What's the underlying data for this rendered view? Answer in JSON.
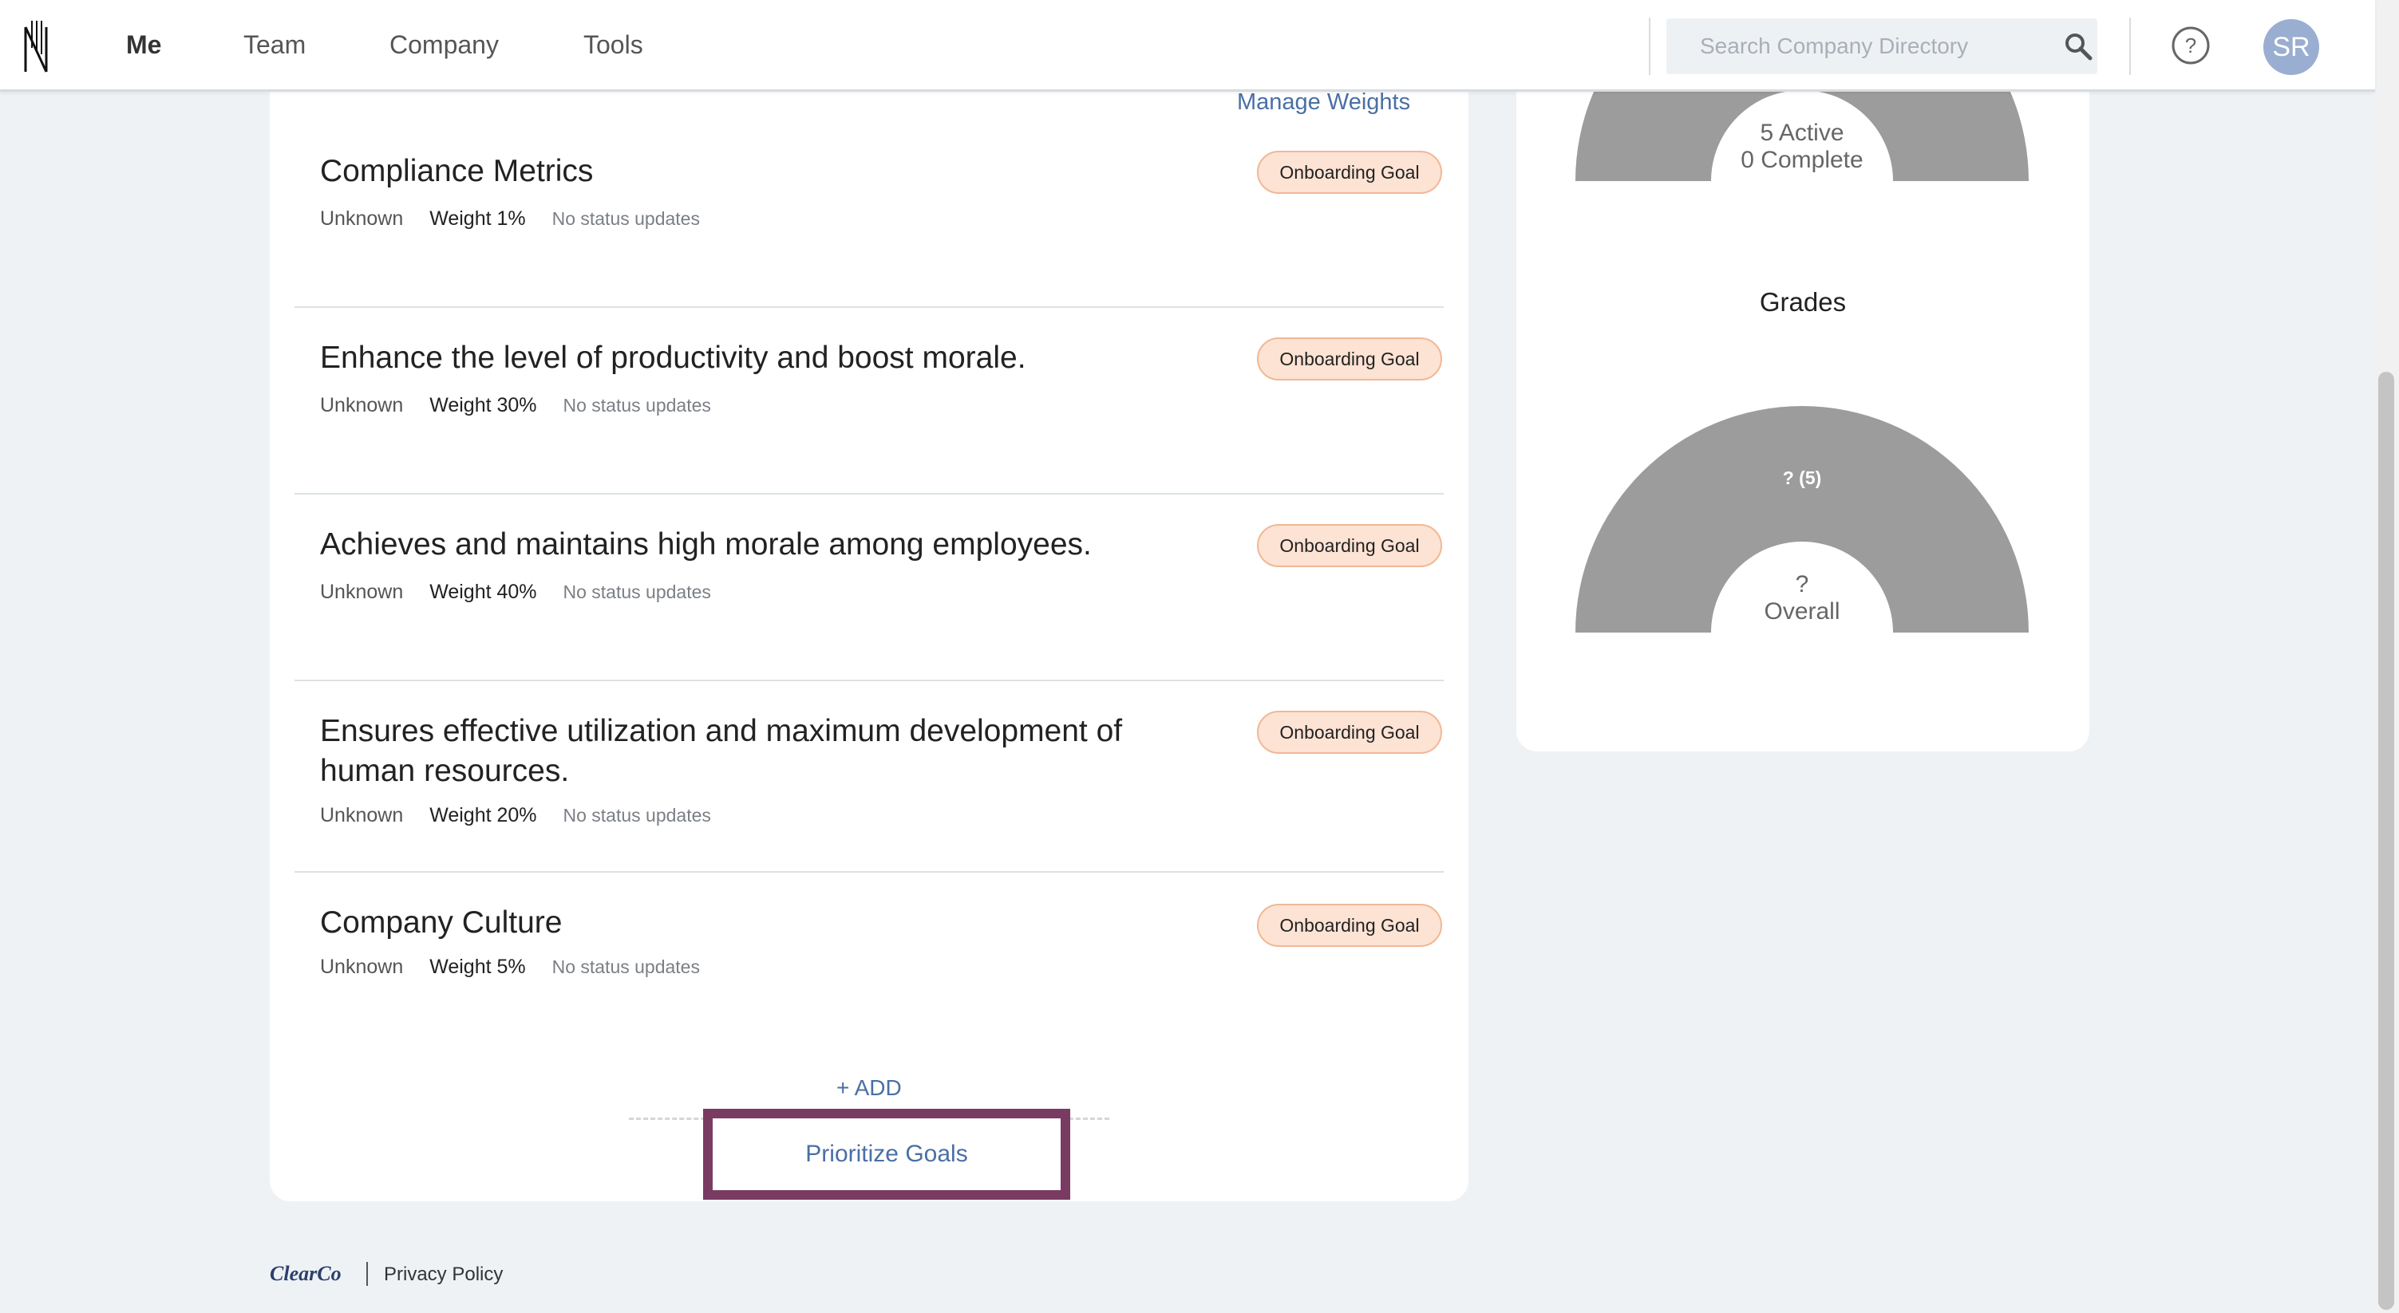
{
  "nav": {
    "items": [
      {
        "label": "Me",
        "active": true
      },
      {
        "label": "Team",
        "active": false
      },
      {
        "label": "Company",
        "active": false
      },
      {
        "label": "Tools",
        "active": false
      }
    ],
    "search_placeholder": "Search Company Directory",
    "search_icon": "search-icon",
    "help_icon": "help-circle-icon",
    "avatar_initials": "SR"
  },
  "goals": {
    "manage_weights_label": "Manage Weights",
    "items": [
      {
        "title": "Compliance Metrics",
        "status": "Unknown",
        "weight": "Weight 1%",
        "updates": "No status updates",
        "badge": "Onboarding Goal"
      },
      {
        "title": "Enhance the level of productivity and boost morale.",
        "status": "Unknown",
        "weight": "Weight 30%",
        "updates": "No status updates",
        "badge": "Onboarding Goal"
      },
      {
        "title": "Achieves and maintains high morale among employees.",
        "status": "Unknown",
        "weight": "Weight 40%",
        "updates": "No status updates",
        "badge": "Onboarding Goal"
      },
      {
        "title": "Ensures effective utilization and maximum development of human resources.",
        "status": "Unknown",
        "weight": "Weight 20%",
        "updates": "No status updates",
        "badge": "Onboarding Goal"
      },
      {
        "title": "Company Culture",
        "status": "Unknown",
        "weight": "Weight 5%",
        "updates": "No status updates",
        "badge": "Onboarding Goal"
      }
    ],
    "add_label": "+ ADD",
    "prioritize_label": "Prioritize Goals"
  },
  "summary": {
    "status_donut": {
      "line1": "5 Active",
      "line2": "0 Complete"
    },
    "grades_title": "Grades",
    "grades_donut": {
      "segment_label": "? (5)",
      "line1": "?",
      "line2": "Overall"
    }
  },
  "footer": {
    "logo_text": "ClearCo",
    "privacy_label": "Privacy Policy"
  },
  "colors": {
    "accent": "#4a6fa5",
    "badge_bg": "#fde3d4",
    "badge_border": "#f0b894",
    "highlight": "#7a3b62",
    "donut": "#9c9c9c",
    "avatar": "#9aaed1"
  }
}
